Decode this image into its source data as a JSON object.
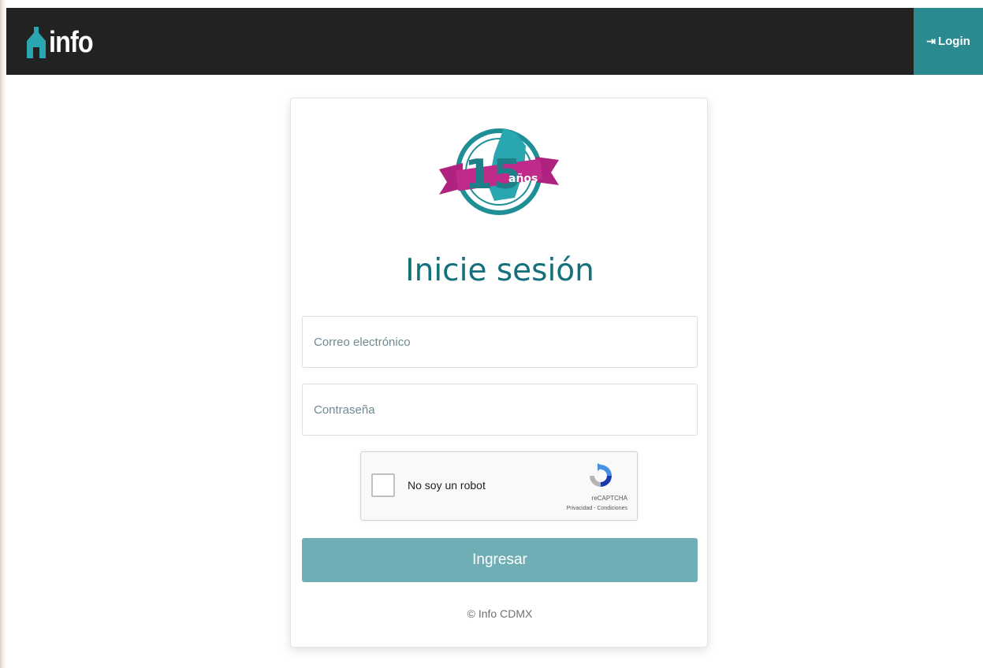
{
  "navbar": {
    "brand_icon": "building-icon",
    "brand_text": "info",
    "login_icon": "sign-in-icon",
    "login_label": "Login",
    "background_color": "#222222",
    "login_color": "#2a8a90"
  },
  "login_card": {
    "logo_icon": "anniversary-15-logo",
    "heading": "Inicie sesión",
    "email_placeholder": "Correo electrónico",
    "email_value": "",
    "password_placeholder": "Contraseña",
    "password_value": "",
    "recaptcha": {
      "label": "No soy un robot",
      "brand": "reCAPTCHA",
      "links": "Privacidad - Condiciones",
      "checked": false
    },
    "submit_label": "Ingresar",
    "submit_color": "#6eaeb4",
    "footer": "© Info CDMX"
  },
  "colors": {
    "heading": "#14707a",
    "accent": "#2a8a90"
  }
}
